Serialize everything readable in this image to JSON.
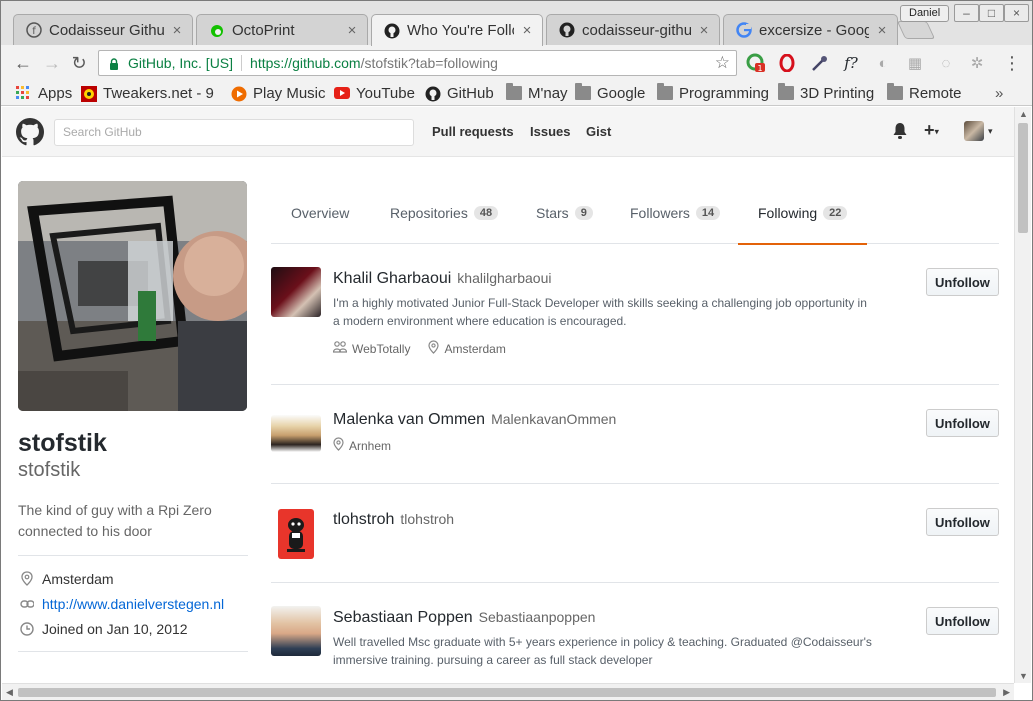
{
  "browser": {
    "profile_name": "Daniel",
    "tabs": [
      {
        "title": "Codaisseur Github",
        "active": false
      },
      {
        "title": "OctoPrint",
        "active": false
      },
      {
        "title": "Who You're Follo",
        "active": true
      },
      {
        "title": "codaisseur-githu",
        "active": false
      },
      {
        "title": "excersize - Goog",
        "active": false
      }
    ],
    "omnibox": {
      "ev_cert": "GitHub, Inc. [US]",
      "url_host": "https://github.com",
      "url_path": "/stofstik?tab=following"
    },
    "ext_badge": "1",
    "bookmarks": [
      {
        "label": "Apps",
        "icon": "apps-grid-icon"
      },
      {
        "label": "Tweakers.net - 9",
        "icon": "tweakers-icon"
      },
      {
        "label": "Play Music",
        "icon": "play-music-icon"
      },
      {
        "label": "YouTube",
        "icon": "youtube-icon"
      },
      {
        "label": "GitHub",
        "icon": "github-icon"
      },
      {
        "label": "M'nay",
        "icon": "folder-icon"
      },
      {
        "label": "Google",
        "icon": "folder-icon"
      },
      {
        "label": "Programming",
        "icon": "folder-icon"
      },
      {
        "label": "3D Printing",
        "icon": "folder-icon"
      },
      {
        "label": "Remote",
        "icon": "folder-icon"
      }
    ]
  },
  "github": {
    "search_placeholder": "Search GitHub",
    "nav": [
      "Pull requests",
      "Issues",
      "Gist"
    ],
    "profile": {
      "fullname": "stofstik",
      "username": "stofstik",
      "bio": "The kind of guy with a Rpi Zero connected to his door",
      "location": "Amsterdam",
      "website": "http://www.danielverstegen.nl",
      "joined": "Joined on Jan 10, 2012"
    },
    "tabs": [
      {
        "label": "Overview",
        "count": ""
      },
      {
        "label": "Repositories",
        "count": "48"
      },
      {
        "label": "Stars",
        "count": "9"
      },
      {
        "label": "Followers",
        "count": "14"
      },
      {
        "label": "Following",
        "count": "22"
      }
    ],
    "unfollow_label": "Unfollow",
    "following": [
      {
        "name": "Khalil Gharbaoui",
        "login": "khalilgharbaoui",
        "bio": "I'm a highly motivated Junior Full-Stack Developer with skills seeking a challenging job opportunity in a modern environment where education is encouraged.",
        "company": "WebTotally",
        "location": "Amsterdam"
      },
      {
        "name": "Malenka van Ommen",
        "login": "MalenkavanOmmen",
        "bio": "",
        "company": "",
        "location": "Arnhem"
      },
      {
        "name": "tlohstroh",
        "login": "tlohstroh",
        "bio": "",
        "company": "",
        "location": ""
      },
      {
        "name": "Sebastiaan Poppen",
        "login": "Sebastiaanpoppen",
        "bio": "Well travelled Msc graduate with 5+ years experience in policy & teaching. Graduated @Codaisseur's immersive training. pursuing a career as full stack developer",
        "company": "",
        "location": ""
      }
    ]
  },
  "colors": {
    "accent_selected_tab": "#e36209",
    "link": "#0366d6",
    "secure_green": "#0b8043"
  }
}
